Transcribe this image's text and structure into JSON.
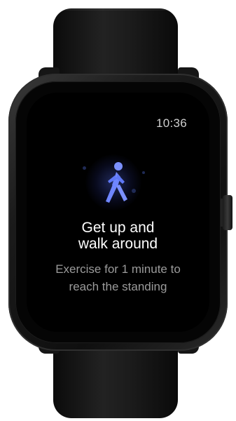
{
  "status_bar": {
    "time": "10:36"
  },
  "reminder": {
    "icon": "walking-person-icon",
    "title_lines": [
      "Get up and",
      "walk around"
    ],
    "subtitle_lines": [
      "Exercise for 1 minute to",
      "reach the standing"
    ]
  },
  "colors": {
    "screen_background": "#000000",
    "icon_accent": "#6f86ff",
    "title_text": "#ffffff",
    "subtitle_text": "#9b9b9b",
    "watch_body": "#1b1b1b"
  }
}
